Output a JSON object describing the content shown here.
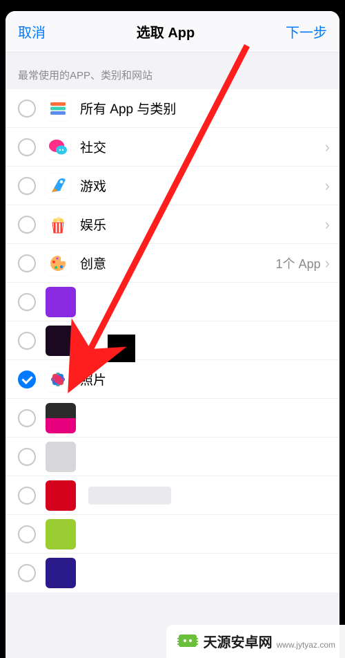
{
  "header": {
    "cancel": "取消",
    "title": "选取 App",
    "next": "下一步"
  },
  "section_header": "最常使用的APP、类别和网站",
  "rows": [
    {
      "id": "all",
      "icon": "stack-icon",
      "label": "所有 App 与类别",
      "checked": false,
      "chevron": false
    },
    {
      "id": "social",
      "icon": "chat-icon",
      "label": "社交",
      "checked": false,
      "chevron": true
    },
    {
      "id": "games",
      "icon": "rocket-icon",
      "label": "游戏",
      "checked": false,
      "chevron": true
    },
    {
      "id": "ent",
      "icon": "popcorn-icon",
      "label": "娱乐",
      "checked": false,
      "chevron": true
    },
    {
      "id": "creative",
      "icon": "palette-icon",
      "label": "创意",
      "detail": "1个 App",
      "checked": false,
      "chevron": true
    },
    {
      "id": "photos",
      "icon": "photos-icon",
      "label": "照片",
      "checked": true,
      "chevron": false
    }
  ],
  "censored_tiles": [
    {
      "color": "#8a2be2"
    },
    {
      "color": "#1b0a1f"
    },
    {
      "color": "#2b2b2b",
      "two_tone": "#e6007e"
    },
    {
      "color": "#d6d6db"
    },
    {
      "color": "#d4021d",
      "label_censor_w": 120
    },
    {
      "color": "#9acd32"
    },
    {
      "color": "#2a1a8a"
    }
  ],
  "watermark": {
    "brand": "天源安卓网",
    "url": "www.jytyaz.com"
  }
}
